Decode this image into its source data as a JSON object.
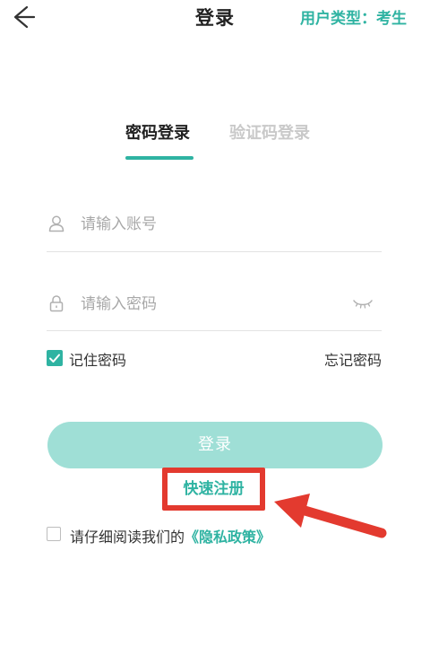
{
  "header": {
    "title": "登录",
    "user_type": "用户类型：考生"
  },
  "tabs": [
    {
      "label": "密码登录",
      "active": true
    },
    {
      "label": "验证码登录",
      "active": false
    }
  ],
  "form": {
    "account_placeholder": "请输入账号",
    "password_placeholder": "请输入密码",
    "remember_label": "记住密码",
    "remember_checked": true,
    "forgot_label": "忘记密码",
    "login_label": "登录"
  },
  "register": {
    "label": "快速注册"
  },
  "privacy": {
    "prefix": "请仔细阅读我们的",
    "link": "《隐私政策》",
    "checked": false
  },
  "colors": {
    "accent": "#2fb3a2",
    "login_button": "#9fdfd6",
    "highlight": "#e33a2f"
  }
}
